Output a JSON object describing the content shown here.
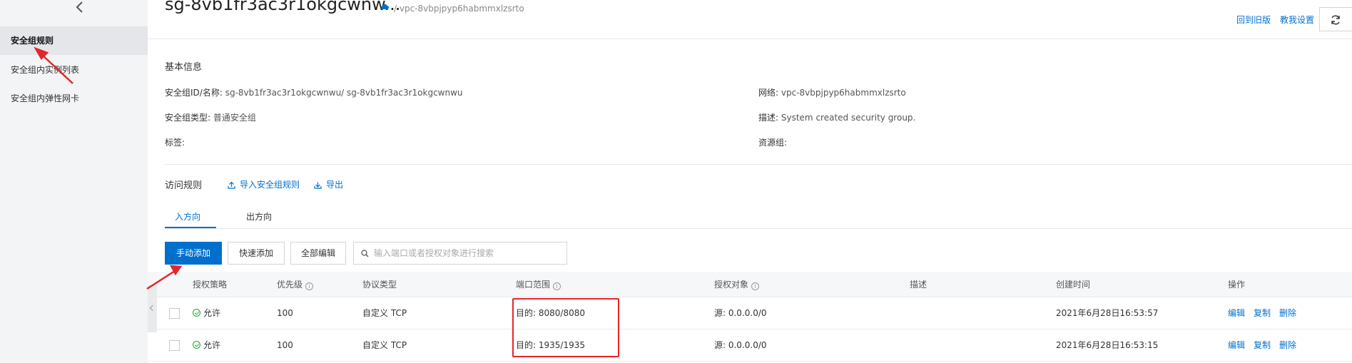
{
  "sidebar": {
    "items": [
      {
        "label": "安全组规则",
        "active": true
      },
      {
        "label": "安全组内实例列表",
        "active": false
      },
      {
        "label": "安全组内弹性网卡",
        "active": false
      }
    ]
  },
  "header": {
    "title": "sg-8vb1fr3ac3r1okgcwnw...",
    "vpc_crumb": "/ vpc-8vbpjpyp6habmmxlzsrto",
    "legacy_link": "回到旧版",
    "teach_link": "教我设置"
  },
  "basic_info": {
    "title": "基本信息",
    "id_label": "安全组ID/名称:",
    "id_value": "sg-8vb1fr3ac3r1okgcwnwu/ sg-8vb1fr3ac3r1okgcwnwu",
    "type_label": "安全组类型:",
    "type_value": "普通安全组",
    "tag_label": "标签:",
    "network_label": "网络:",
    "network_value": "vpc-8vbpjpyp6habmmxlzsrto",
    "desc_label": "描述:",
    "desc_value": "System created security group.",
    "resource_label": "资源组:"
  },
  "rules": {
    "title": "访问规则",
    "import_label": "导入安全组规则",
    "export_label": "导出",
    "tabs": [
      {
        "label": "入方向",
        "active": true
      },
      {
        "label": "出方向",
        "active": false
      }
    ],
    "toolbar": {
      "add_label": "手动添加",
      "quick_label": "快速添加",
      "batch_label": "全部编辑",
      "search_placeholder": "输入端口或者授权对象进行搜索"
    },
    "columns": [
      "授权策略",
      "优先级",
      "协议类型",
      "端口范围",
      "授权对象",
      "描述",
      "创建时间",
      "操作"
    ],
    "rows": [
      {
        "policy": "允许",
        "priority": "100",
        "protocol": "自定义 TCP",
        "port": "目的: 8080/8080",
        "source": "源: 0.0.0.0/0",
        "description": "",
        "created": "2021年6月28日16:53:57",
        "actions": [
          "编辑",
          "复制",
          "删除"
        ]
      },
      {
        "policy": "允许",
        "priority": "100",
        "protocol": "自定义 TCP",
        "port": "目的: 1935/1935",
        "source": "源: 0.0.0.0/0",
        "description": "",
        "created": "2021年6月28日16:53:15",
        "actions": [
          "编辑",
          "复制",
          "删除"
        ]
      }
    ]
  },
  "colors": {
    "accent": "#0070cc",
    "annotation": "#e3262b",
    "allow": "#2aa33c"
  },
  "icons": [
    "chevron-left-icon",
    "cloud-icon",
    "refresh-icon",
    "upload-icon",
    "download-icon",
    "search-icon",
    "info-icon",
    "check-circle-icon"
  ]
}
